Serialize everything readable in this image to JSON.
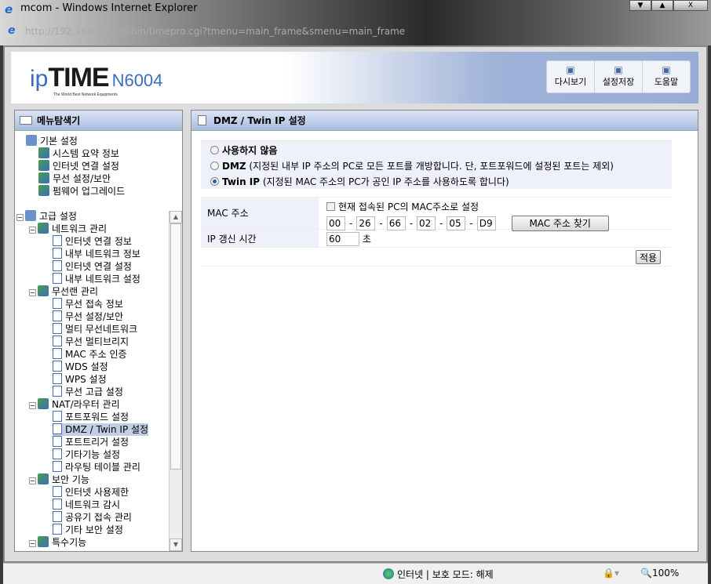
{
  "window": {
    "title": "mcom - Windows Internet Explorer",
    "url": "http://192.168.0.1/cgi-bin/timepro.cgi?tmenu=main_frame&smenu=main_frame",
    "controls": [
      "▼",
      "▲",
      "X"
    ]
  },
  "banner": {
    "logo_ip": "ip",
    "logo_time": "TIME",
    "model": "N6004",
    "tagline": "The World Best Network Equipments",
    "tools": [
      {
        "label": "다시보기",
        "icon": "refresh-icon"
      },
      {
        "label": "설정저장",
        "icon": "save-icon"
      },
      {
        "label": "도움말",
        "icon": "help-book-icon"
      }
    ]
  },
  "sidebar": {
    "title": "메뉴탐색기",
    "basic": {
      "label": "기본 설정",
      "items": [
        "시스템 요약 정보",
        "인터넷 연결 설정",
        "무선 설정/보안",
        "펌웨어 업그레이드"
      ]
    },
    "advanced": {
      "label": "고급 설정",
      "groups": [
        {
          "label": "네트워크 관리",
          "items": [
            "인터넷 연결 정보",
            "내부 네트워크 정보",
            "인터넷 연결 설정",
            "내부 네트워크 설정"
          ]
        },
        {
          "label": "무선랜 관리",
          "items": [
            "무선 접속 정보",
            "무선 설정/보안",
            "멀티 무선네트워크",
            "무선 멀티브리지",
            "MAC 주소 인증",
            "WDS 설정",
            "WPS 설정",
            "무선 고급 설정"
          ]
        },
        {
          "label": "NAT/라우터 관리",
          "items": [
            "포트포워드 설정",
            "DMZ / Twin IP 설정",
            "포트트리거 설정",
            "기타기능 설정",
            "라우팅 테이블 관리"
          ]
        },
        {
          "label": "보안 기능",
          "items": [
            "인터넷 사용제한",
            "네트워크 감시",
            "공유기 접속 관리",
            "기타 보안 설정"
          ]
        },
        {
          "label": "특수기능",
          "items": []
        }
      ]
    },
    "selected": "DMZ / Twin IP 설정"
  },
  "main": {
    "title": "DMZ / Twin IP 설정",
    "options": [
      {
        "bold": "사용하지 않음",
        "desc": "",
        "checked": false
      },
      {
        "bold": "DMZ",
        "desc": " (지정된 내부 IP 주소의 PC로 모든 포트를 개방합니다. 단, 포트포워드에 설정된 포트는 제외)",
        "checked": false
      },
      {
        "bold": "Twin IP",
        "desc": " (지정된 MAC 주소의 PC가 공인 IP 주소를 사용하도록 합니다)",
        "checked": true
      }
    ],
    "mac_label": "MAC 주소",
    "mac_checkbox": "현재 접속된 PC의 MAC주소로 설정",
    "mac": [
      "00",
      "26",
      "66",
      "02",
      "05",
      "D9"
    ],
    "mac_sep": "-",
    "mac_find": "MAC 주소 찾기",
    "ip_label": "IP 갱신 시간",
    "ip_value": "60",
    "ip_unit": "초",
    "apply": "적용"
  },
  "status": {
    "zone": "인터넷 | 보호 모드: 해제",
    "zoom": "100%"
  }
}
